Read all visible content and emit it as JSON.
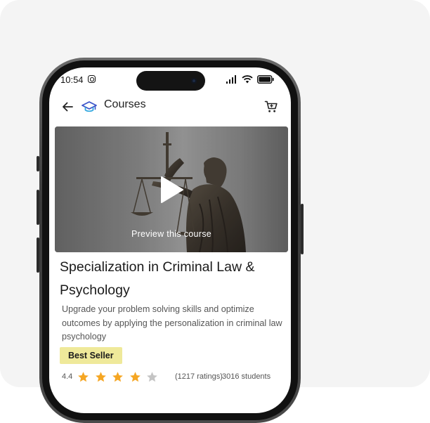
{
  "status_bar": {
    "time": "10:54"
  },
  "header": {
    "title": "Courses"
  },
  "video": {
    "preview_label": "Preview this course"
  },
  "course": {
    "title": "Specialization in Criminal Law & Psychology",
    "description": "Upgrade your problem solving skills and optimize outcomes by applying the personalization in criminal law psychology",
    "badge": "Best Seller",
    "rating": "4.4",
    "stars_filled": 4,
    "stars_total": 5,
    "ratings_count": "(1217 ratings)",
    "students": "3016 students"
  },
  "colors": {
    "star_filled": "#f5a623",
    "star_empty": "#c4c4c4",
    "badge_bg": "#efe99a",
    "cap_primary": "#3b55c9",
    "cap_accent": "#35a9e0"
  },
  "icons": [
    "instagram-icon",
    "signal-icon",
    "wifi-icon",
    "battery-icon",
    "back-arrow-icon",
    "graduation-cap-icon",
    "cart-icon",
    "play-icon",
    "star-icon"
  ]
}
